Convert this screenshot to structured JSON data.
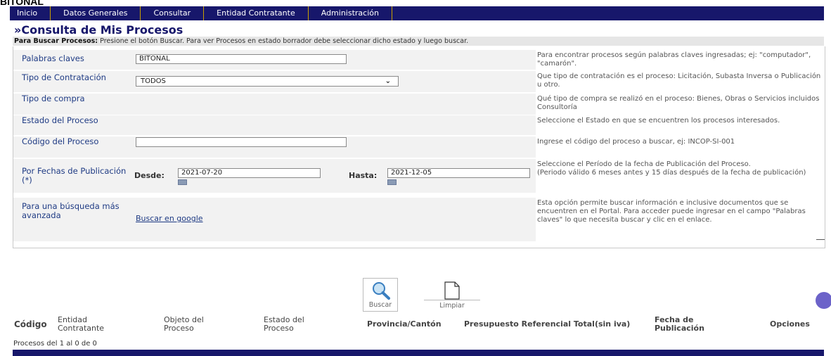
{
  "top_partial_text": "BITONAL",
  "nav": [
    "Inicio",
    "Datos Generales",
    "Consultar",
    "Entidad Contratante",
    "Administración"
  ],
  "title": "»Consulta de Mis Procesos",
  "instructions": {
    "bold": "Para Buscar Procesos:",
    "text": " Presione el botón Buscar. Para ver Procesos en estado borrador debe seleccionar dicho estado y luego buscar."
  },
  "form": {
    "palabras_label": "Palabras claves",
    "palabras_value": "BITONAL",
    "palabras_help": "Para encontrar procesos según palabras claves ingresadas; ej: \"computador\", \"camarón\".",
    "tipo_contratacion_label": "Tipo de Contratación",
    "tipo_contratacion_value": "TODOS",
    "tipo_contratacion_help": "Que tipo de contratación es el proceso: Licitación, Subasta Inversa o Publicación u otro.",
    "tipo_compra_label": "Tipo de compra",
    "tipo_compra_help": "Qué tipo de compra se realizó en el proceso: Bienes, Obras o Servicios incluidos Consultoría",
    "estado_label": "Estado del Proceso",
    "estado_help": "Seleccione el Estado en que se encuentren los procesos interesados.",
    "codigo_label": "Código del Proceso",
    "codigo_value": "",
    "codigo_help": "Ingrese el código del proceso a buscar, ej: INCOP-SI-001",
    "fechas_label": "Por Fechas de Publicación (*)",
    "desde_label": "Desde:",
    "desde_value": "2021-07-20",
    "hasta_label": "Hasta:",
    "hasta_value": "2021-12-05",
    "fechas_help": "Seleccione el Período de la fecha de Publicación del Proceso.\n(Periodo válido 6 meses antes y 15 días después de la fecha de publicación)",
    "avanzada_label": "Para una búsqueda más avanzada",
    "avanzada_link": "Buscar en google",
    "avanzada_help": "Esta opción permite buscar información e inclusive documentos que se encuentren en el Portal. Para acceder puede ingresar en el campo \"Palabras claves\" lo que necesita buscar y clic en el enlace."
  },
  "buttons": {
    "buscar": "Buscar",
    "limpiar": "Limpiar"
  },
  "table_headers": [
    "Código",
    "Entidad Contratante",
    "Objeto del Proceso",
    "Estado del Proceso",
    "Provincia/Cantón",
    "Presupuesto Referencial Total(sin iva)",
    "Fecha de Publicación",
    "Opciones"
  ],
  "procesos_info": "Procesos del 1 al 0 de 0",
  "icons": [
    "search-icon",
    "document-icon",
    "calendar-icon",
    "chevron-down-icon"
  ],
  "colors": {
    "nav_bg": "#17176b",
    "label_color": "#1f3b84",
    "label_bg": "#f2f2f2"
  }
}
